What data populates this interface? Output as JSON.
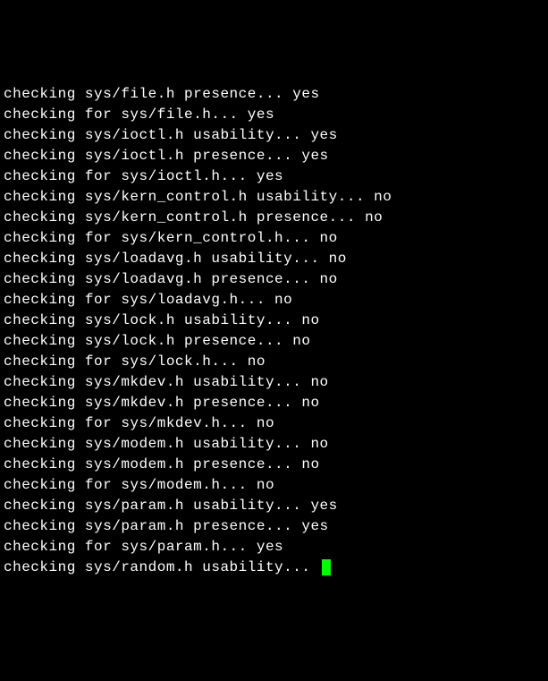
{
  "terminal": {
    "lines": [
      "checking sys/file.h presence... yes",
      "checking for sys/file.h... yes",
      "checking sys/ioctl.h usability... yes",
      "checking sys/ioctl.h presence... yes",
      "checking for sys/ioctl.h... yes",
      "checking sys/kern_control.h usability... no",
      "checking sys/kern_control.h presence... no",
      "checking for sys/kern_control.h... no",
      "checking sys/loadavg.h usability... no",
      "checking sys/loadavg.h presence... no",
      "checking for sys/loadavg.h... no",
      "checking sys/lock.h usability... no",
      "checking sys/lock.h presence... no",
      "checking for sys/lock.h... no",
      "checking sys/mkdev.h usability... no",
      "checking sys/mkdev.h presence... no",
      "checking for sys/mkdev.h... no",
      "checking sys/modem.h usability... no",
      "checking sys/modem.h presence... no",
      "checking for sys/modem.h... no",
      "checking sys/param.h usability... yes",
      "checking sys/param.h presence... yes",
      "checking for sys/param.h... yes",
      "checking sys/random.h usability... "
    ],
    "cursor_color": "#00ff00"
  }
}
